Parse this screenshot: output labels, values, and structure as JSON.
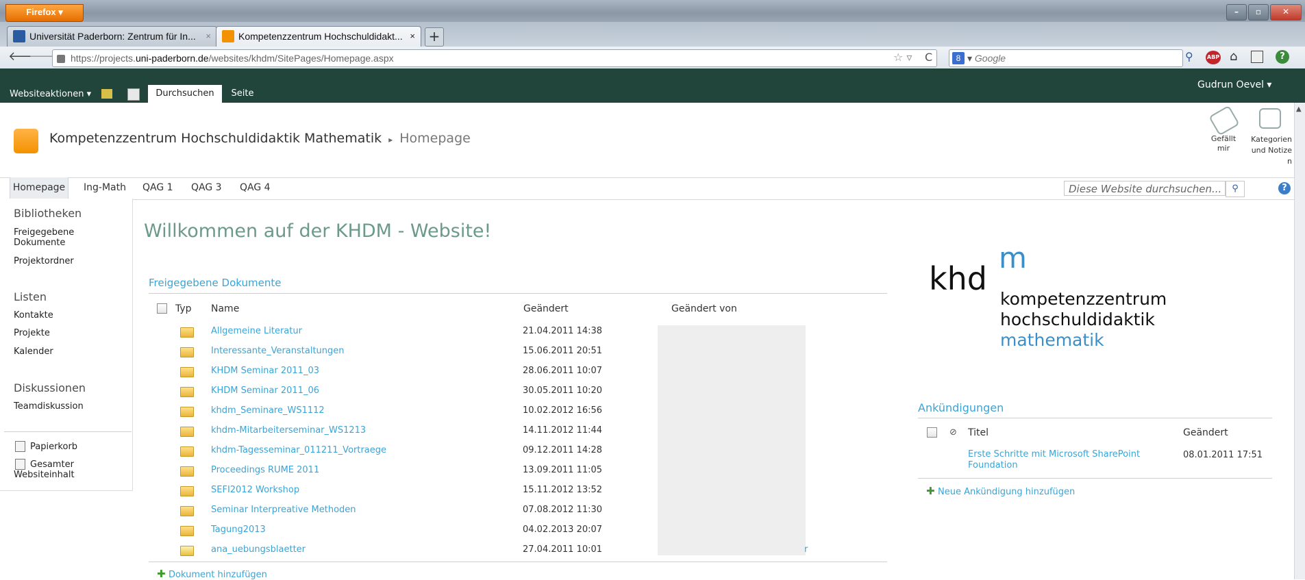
{
  "browser": {
    "app_button": "Firefox ▾",
    "tabs": [
      {
        "label": "Universität Paderborn: Zentrum für In...",
        "active": false
      },
      {
        "label": "Kompetenzzentrum Hochschuldidakt...",
        "active": true
      }
    ],
    "new_tab": "+",
    "url_prefix": "https://projects.",
    "url_domain": "uni-paderborn.de",
    "url_path": "/websites/khdm/SitePages/Homepage.aspx",
    "search_placeholder": "Google",
    "search_engine_badge": "8",
    "adblock_badge": "ABP"
  },
  "ribbon": {
    "site_actions": "Websiteaktionen ▾",
    "tab_browse": "Durchsuchen",
    "tab_page": "Seite",
    "user": "Gudrun Oevel ▾",
    "like_label": "Gefällt mir",
    "tags_label": "Kategorien und Notizen"
  },
  "header": {
    "site_title": "Kompetenzzentrum Hochschuldidaktik Mathematik",
    "separator": "▸",
    "page_title": "Homepage"
  },
  "topnav": {
    "items": [
      "Homepage",
      "Ing-Math",
      "QAG 1",
      "QAG 3",
      "QAG 4"
    ],
    "search_placeholder": "Diese Website durchsuchen...",
    "help": "?"
  },
  "leftnav": {
    "libraries_heading": "Bibliotheken",
    "shared_docs": "Freigegebene Dokumente",
    "project_folder": "Projektordner",
    "lists_heading": "Listen",
    "contacts": "Kontakte",
    "projects": "Projekte",
    "calendar": "Kalender",
    "discussions_heading": "Diskussionen",
    "team_discussion": "Teamdiskussion",
    "recycle_bin": "Papierkorb",
    "all_content": "Gesamter Websiteinhalt"
  },
  "main": {
    "welcome": "Willkommen auf der KHDM - Website!",
    "docs_webpart_title": "Freigegebene Dokumente",
    "columns": {
      "type": "Typ",
      "name": "Name",
      "modified": "Geändert",
      "modified_by": "Geändert von"
    },
    "documents": [
      {
        "name": "Allgemeine Literatur",
        "modified": "21.04.2011 14:38"
      },
      {
        "name": "Interessante_Veranstaltungen",
        "modified": "15.06.2011 20:51"
      },
      {
        "name": "KHDM Seminar 2011_03",
        "modified": "28.06.2011 10:07"
      },
      {
        "name": "KHDM Seminar 2011_06",
        "modified": "30.05.2011 10:20"
      },
      {
        "name": "khdm_Seminare_WS1112",
        "modified": "10.02.2012 16:56"
      },
      {
        "name": "khdm-Mitarbeiterseminar_WS1213",
        "modified": "14.11.2012 11:44"
      },
      {
        "name": "khdm-Tagesseminar_011211_Vortraege",
        "modified": "09.12.2011 14:28"
      },
      {
        "name": "Proceedings RUME 2011",
        "modified": "13.09.2011 11:05"
      },
      {
        "name": "SEFI2012 Workshop",
        "modified": "15.11.2012 13:52"
      },
      {
        "name": "Seminar Interpreative Methoden",
        "modified": "07.08.2012 11:30"
      },
      {
        "name": "Tagung2013",
        "modified": "04.02.2013 20:07"
      },
      {
        "name": "ana_uebungsblaetter",
        "modified": "27.04.2011 10:01"
      }
    ],
    "trailing_char": "r",
    "add_document": "Dokument hinzufügen"
  },
  "logo": {
    "khd": "khd",
    "m": "m",
    "line1": "kompetenzzentrum",
    "line2": "hochschuldidaktik",
    "line3": "mathematik"
  },
  "announcements": {
    "title": "Ankündigungen",
    "col_title": "Titel",
    "col_modified": "Geändert",
    "item_title": "Erste Schritte mit Microsoft SharePoint Foundation",
    "item_modified": "08.01.2011 17:51",
    "add": "Neue Ankündigung hinzufügen"
  },
  "colors": {
    "ribbon": "#21453a",
    "link": "#3aa4d6",
    "welcome": "#6b9a8a",
    "logo_blue": "#3a8fc8"
  }
}
